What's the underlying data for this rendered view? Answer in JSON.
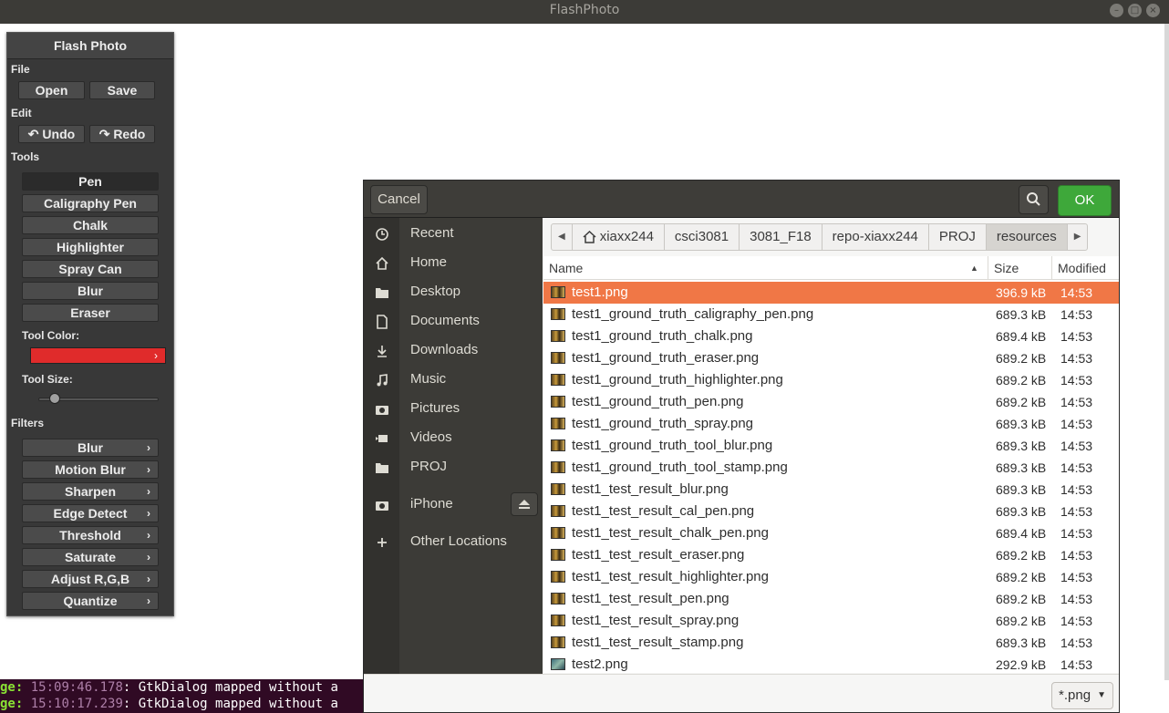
{
  "window": {
    "title": "FlashPhoto"
  },
  "panel": {
    "title": "Flash Photo",
    "file_label": "File",
    "open": "Open",
    "save": "Save",
    "edit_label": "Edit",
    "undo": "Undo",
    "redo": "Redo",
    "tools_label": "Tools",
    "tools": [
      "Pen",
      "Caligraphy Pen",
      "Chalk",
      "Highlighter",
      "Spray Can",
      "Blur",
      "Eraser"
    ],
    "active_tool": "Pen",
    "tool_color_label": "Tool Color:",
    "tool_color": "#e02b2b",
    "tool_size_label": "Tool Size:",
    "tool_size_level": 0.1,
    "filters_label": "Filters",
    "filters": [
      "Blur",
      "Motion Blur",
      "Sharpen",
      "Edge Detect",
      "Threshold",
      "Saturate",
      "Adjust R,G,B",
      "Quantize"
    ]
  },
  "terminal": {
    "lines": [
      {
        "prefix": "ge:",
        "time": "15:09:46.178",
        "text": ": GtkDialog mapped without a"
      },
      {
        "prefix": "ge:",
        "time": "15:10:17.239",
        "text": ": GtkDialog mapped without a"
      }
    ]
  },
  "dialog": {
    "cancel": "Cancel",
    "ok": "OK",
    "search_icon": "search-icon",
    "places": [
      {
        "label": "Recent",
        "icon": "clock-icon"
      },
      {
        "label": "Home",
        "icon": "home-icon"
      },
      {
        "label": "Desktop",
        "icon": "folder-icon"
      },
      {
        "label": "Documents",
        "icon": "document-icon"
      },
      {
        "label": "Downloads",
        "icon": "download-icon"
      },
      {
        "label": "Music",
        "icon": "music-icon"
      },
      {
        "label": "Pictures",
        "icon": "camera-icon"
      },
      {
        "label": "Videos",
        "icon": "video-icon"
      },
      {
        "label": "PROJ",
        "icon": "folder-icon"
      },
      {
        "label": "iPhone",
        "icon": "camera-icon"
      },
      {
        "label": "Other Locations",
        "icon": "plus-icon"
      }
    ],
    "breadcrumbs": [
      "xiaxx244",
      "csci3081",
      "3081_F18",
      "repo-xiaxx244",
      "PROJ",
      "resources"
    ],
    "columns": {
      "name": "Name",
      "size": "Size",
      "modified": "Modified"
    },
    "files": [
      {
        "name": "test1.png",
        "size": "396.9 kB",
        "modified": "14:53"
      },
      {
        "name": "test1_ground_truth_caligraphy_pen.png",
        "size": "689.3 kB",
        "modified": "14:53"
      },
      {
        "name": "test1_ground_truth_chalk.png",
        "size": "689.4 kB",
        "modified": "14:53"
      },
      {
        "name": "test1_ground_truth_eraser.png",
        "size": "689.2 kB",
        "modified": "14:53"
      },
      {
        "name": "test1_ground_truth_highlighter.png",
        "size": "689.2 kB",
        "modified": "14:53"
      },
      {
        "name": "test1_ground_truth_pen.png",
        "size": "689.2 kB",
        "modified": "14:53"
      },
      {
        "name": "test1_ground_truth_spray.png",
        "size": "689.3 kB",
        "modified": "14:53"
      },
      {
        "name": "test1_ground_truth_tool_blur.png",
        "size": "689.3 kB",
        "modified": "14:53"
      },
      {
        "name": "test1_ground_truth_tool_stamp.png",
        "size": "689.3 kB",
        "modified": "14:53"
      },
      {
        "name": "test1_test_result_blur.png",
        "size": "689.3 kB",
        "modified": "14:53"
      },
      {
        "name": "test1_test_result_cal_pen.png",
        "size": "689.3 kB",
        "modified": "14:53"
      },
      {
        "name": "test1_test_result_chalk_pen.png",
        "size": "689.4 kB",
        "modified": "14:53"
      },
      {
        "name": "test1_test_result_eraser.png",
        "size": "689.2 kB",
        "modified": "14:53"
      },
      {
        "name": "test1_test_result_highlighter.png",
        "size": "689.2 kB",
        "modified": "14:53"
      },
      {
        "name": "test1_test_result_pen.png",
        "size": "689.2 kB",
        "modified": "14:53"
      },
      {
        "name": "test1_test_result_spray.png",
        "size": "689.2 kB",
        "modified": "14:53"
      },
      {
        "name": "test1_test_result_stamp.png",
        "size": "689.3 kB",
        "modified": "14:53"
      },
      {
        "name": "test2.png",
        "size": "292.9 kB",
        "modified": "14:53"
      }
    ],
    "selected_file": "test1.png",
    "filter": "*.png",
    "colors": {
      "selection": "#f07746",
      "ok": "#3ea83a",
      "sidebar": "#3c3b37"
    }
  }
}
